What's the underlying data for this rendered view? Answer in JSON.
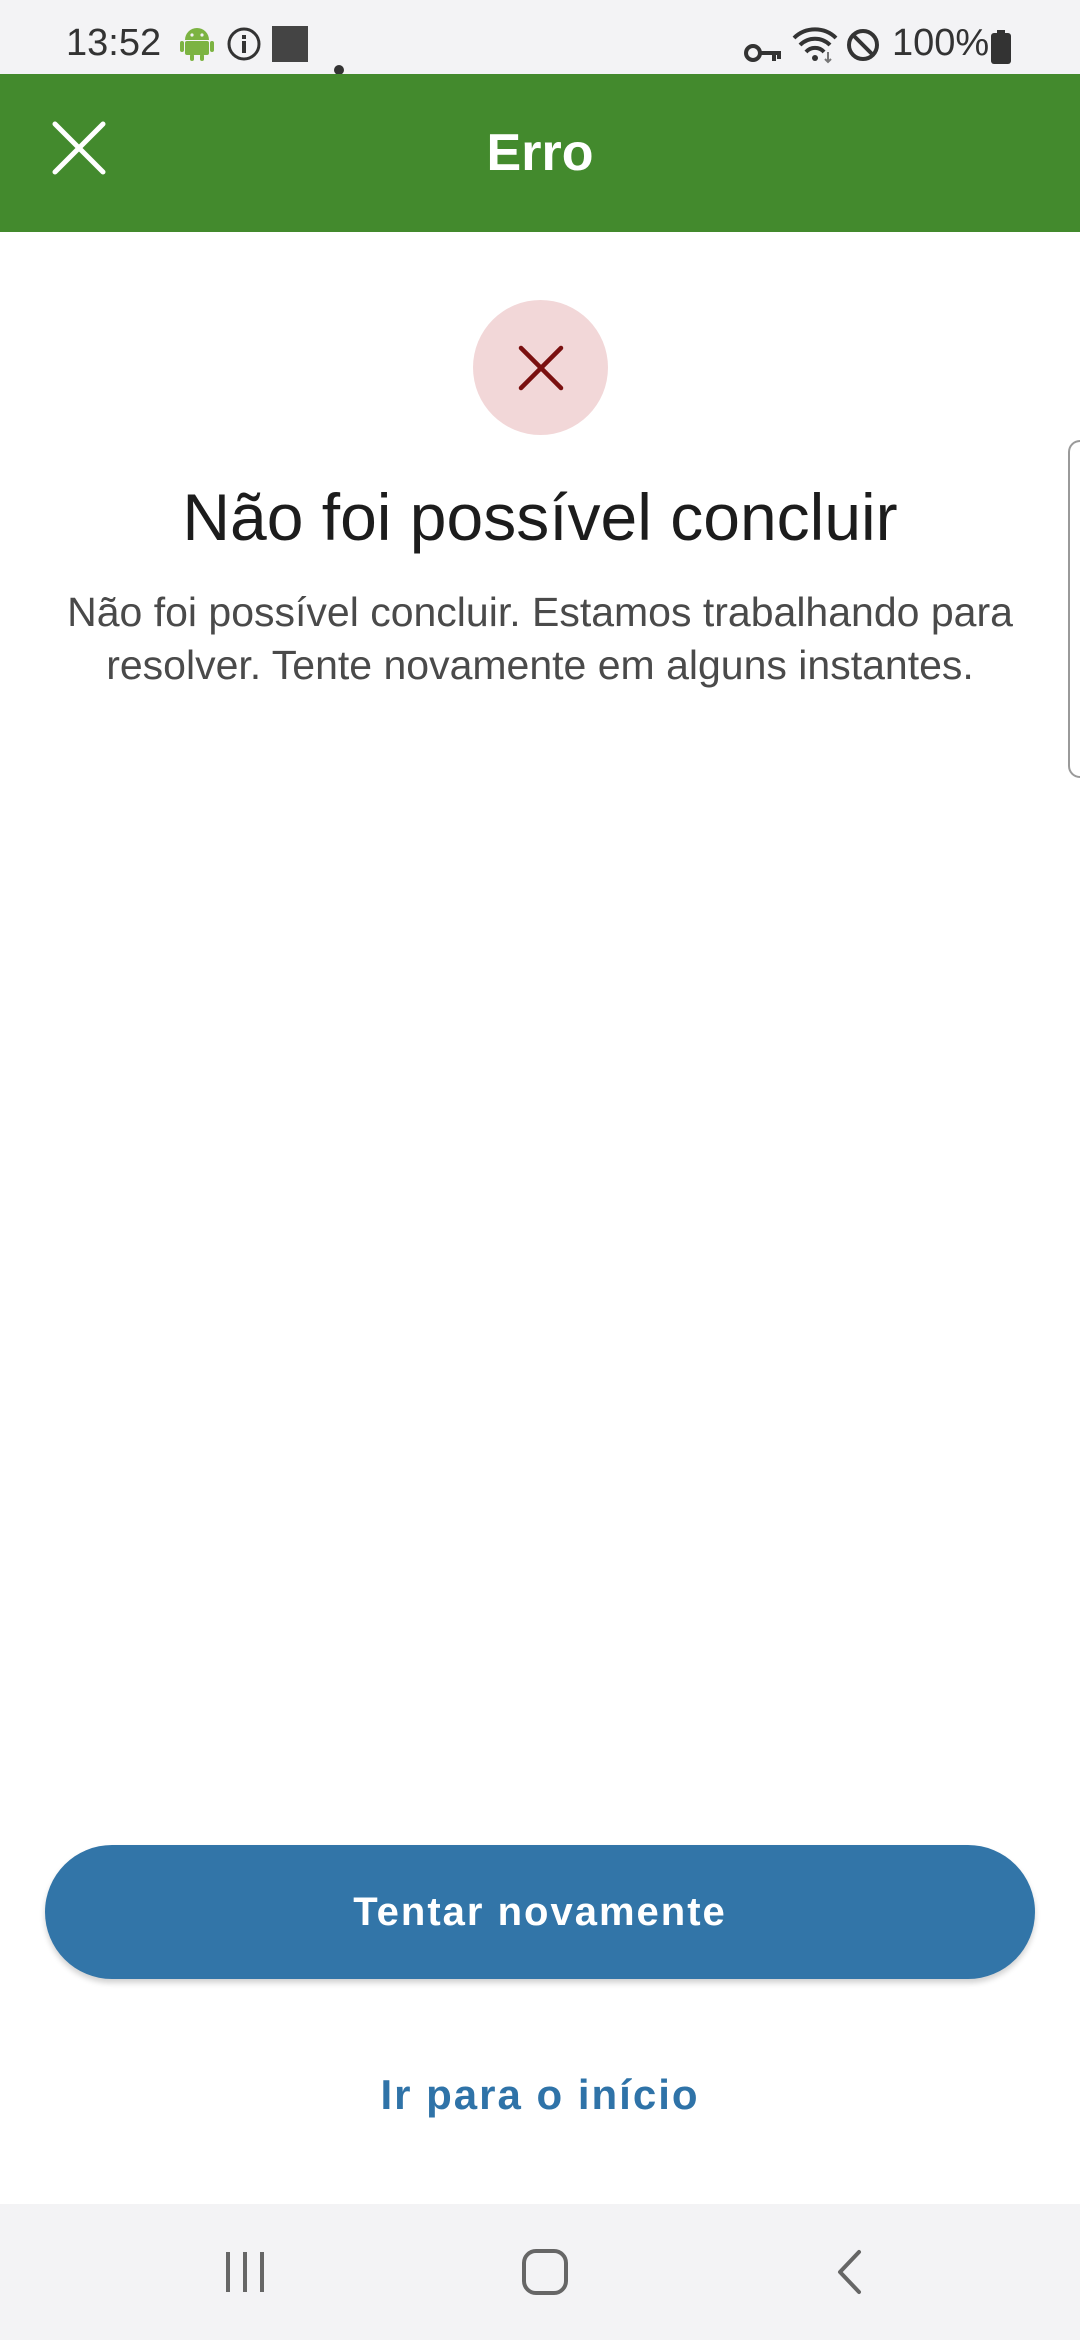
{
  "status_bar": {
    "time": "13:52",
    "battery": "100%",
    "icons": [
      "android-icon",
      "info-icon",
      "square-icon",
      "dot-icon",
      "vpn-key-icon",
      "wifi-icon",
      "do-not-disturb-icon",
      "battery-icon"
    ]
  },
  "app_bar": {
    "title": "Erro",
    "close_icon": "close-icon",
    "color": "#438a2d"
  },
  "content": {
    "status_icon": "error-x-icon",
    "headline": "Não foi possível concluir",
    "description": "Não foi possível concluir. Estamos trabalhando para resolver. Tente novamente em alguns instantes."
  },
  "actions": {
    "retry_label": "Tentar novamente",
    "home_label": "Ir para o início",
    "primary_color": "#3275a8"
  },
  "nav_bar": {
    "icons": [
      "recents-icon",
      "home-icon",
      "back-icon"
    ]
  }
}
